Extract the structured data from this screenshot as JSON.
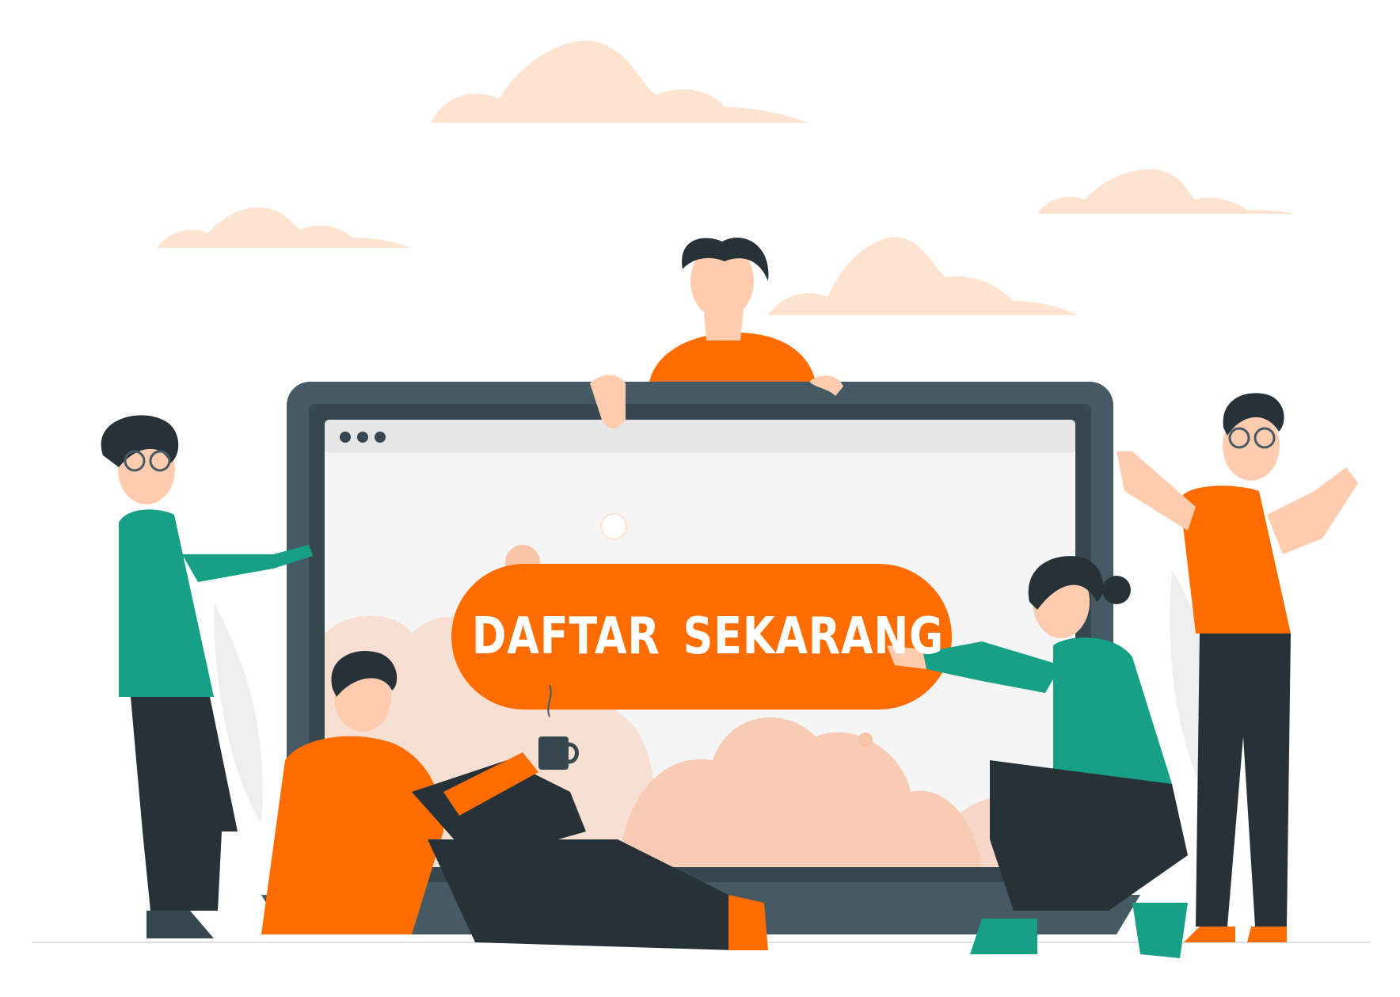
{
  "cta": {
    "label": "DAFTAR SEKARANG"
  },
  "colors": {
    "accent": "#FF6D00",
    "teal": "#16A085",
    "dark": "#263238",
    "monitor": "#455A64",
    "cloud": "#FDE3D0",
    "screen": "#F5F5F5"
  },
  "icons": [
    "window-dots-icon",
    "coffee-cup-icon",
    "cloud-icon"
  ]
}
